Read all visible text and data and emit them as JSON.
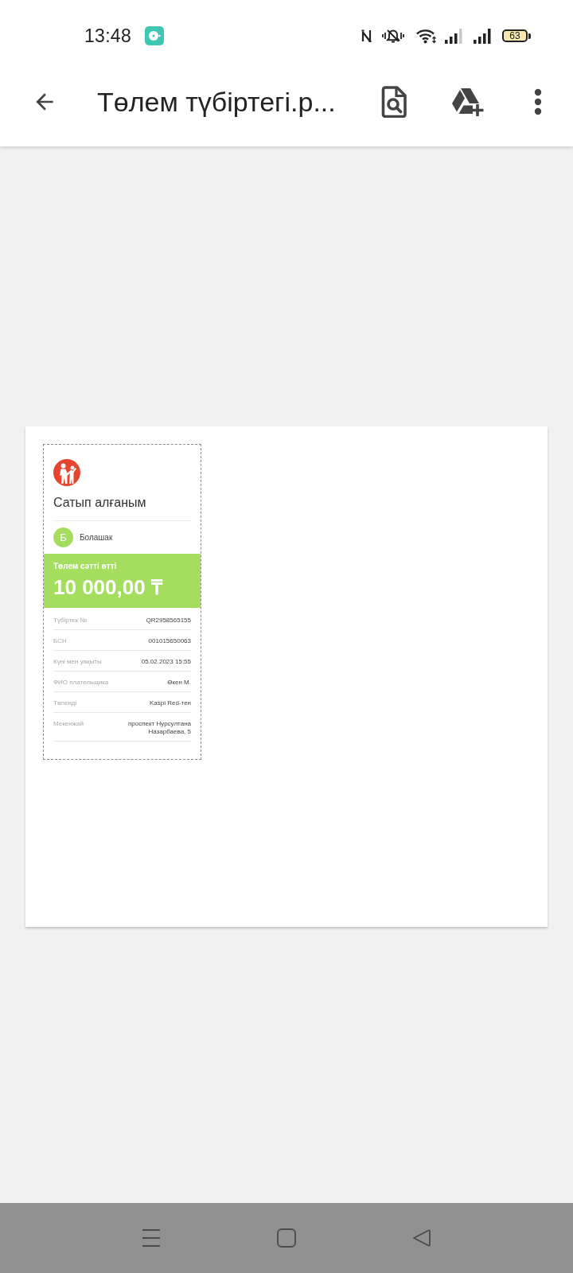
{
  "status_bar": {
    "time": "13:48",
    "battery": "63"
  },
  "toolbar": {
    "title": "Төлем түбіртегі.р..."
  },
  "document": {
    "receipt": {
      "title": "Сатып алғаным",
      "merchant": {
        "initial": "Б",
        "name": "Болашак"
      },
      "status": "Төлем сәтті өтті",
      "amount": "10 000,00 ₸",
      "details": [
        {
          "label": "Түбіртек №",
          "value": "QR2958565155"
        },
        {
          "label": "БСН",
          "value": "001015650063"
        },
        {
          "label": "Күні мен уақыты",
          "value": "05.02.2023 15:55"
        },
        {
          "label": "ФИО плательщика",
          "value": "Өкен М."
        },
        {
          "label": "Төленді",
          "value": "Kaspi Red-тен"
        },
        {
          "label": "Мекенжай",
          "value": "проспект Нурсултана Назарбаева, 5"
        }
      ]
    }
  }
}
